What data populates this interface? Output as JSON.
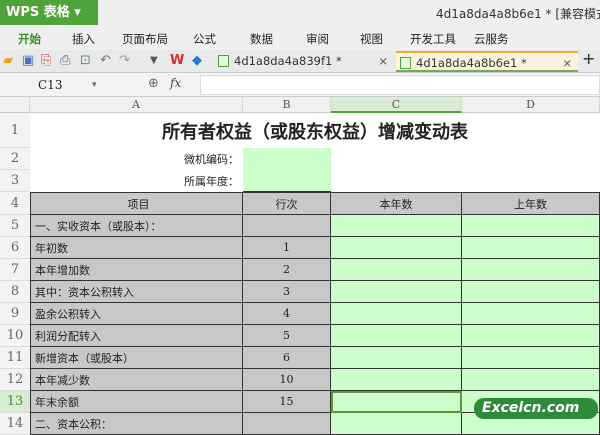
{
  "app": {
    "name": "WPS 表格",
    "doc_title": "4d1a8da4a8b6e1 * [兼容模式]"
  },
  "menu": [
    "开始",
    "插入",
    "页面布局",
    "公式",
    "数据",
    "审阅",
    "视图",
    "开发工具",
    "云服务"
  ],
  "tabs": [
    {
      "label": "4d1a8da4a839f1 *"
    },
    {
      "label": "4d1a8da4a8b6e1 *"
    }
  ],
  "formula_bar": {
    "cell_ref": "C13",
    "fx": "fx",
    "value": ""
  },
  "columns": [
    "A",
    "B",
    "C",
    "D"
  ],
  "sheet": {
    "title": "所有者权益（或股东权益）增减变动表",
    "code_label": "微机编码：",
    "year_label": "所属年度：",
    "headers": [
      "项目",
      "行次",
      "本年数",
      "上年数"
    ],
    "rows": [
      {
        "n": "5",
        "item": "一、实收资本（或股本）：",
        "line": ""
      },
      {
        "n": "6",
        "item": "年初数",
        "line": "1"
      },
      {
        "n": "7",
        "item": "本年增加数",
        "line": "2"
      },
      {
        "n": "8",
        "item": "其中：资本公积转入",
        "line": "3"
      },
      {
        "n": "9",
        "item": "盈余公积转入",
        "line": "4"
      },
      {
        "n": "10",
        "item": "利润分配转入",
        "line": "5"
      },
      {
        "n": "11",
        "item": "新增资本（或股本）",
        "line": "6"
      },
      {
        "n": "12",
        "item": "本年减少数",
        "line": "10"
      },
      {
        "n": "13",
        "item": "年末余额",
        "line": "15"
      },
      {
        "n": "14",
        "item": "二、资本公积：",
        "line": ""
      }
    ]
  },
  "watermark": "Excelcn.com"
}
